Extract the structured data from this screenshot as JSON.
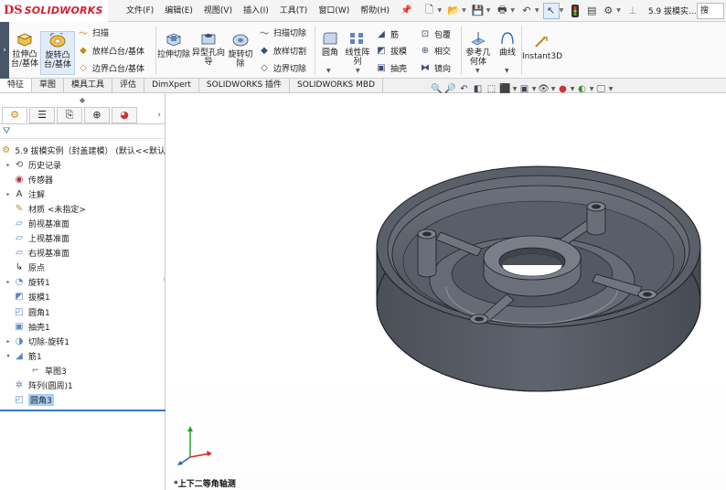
{
  "app": {
    "brand_mark": "DS",
    "brand_name": "SOLIDWORKS",
    "document_title": "5.9 拔模实...",
    "search_placeholder": "搜"
  },
  "menu": [
    "文件(F)",
    "编辑(E)",
    "视图(V)",
    "插入(I)",
    "工具(T)",
    "窗口(W)",
    "帮助(H)"
  ],
  "ribbon": {
    "extrude_boss": "拉伸凸台/基体",
    "revolve_boss": "旋转凸台/基体",
    "sweep": "扫描",
    "loft": "放样凸台/基体",
    "boundary_boss": "边界凸台/基体",
    "extrude_cut": "拉伸切除",
    "hole_wizard": "异型孔向导",
    "revolve_cut": "旋转切除",
    "swept_cut": "扫描切除",
    "lofted_cut": "放样切割",
    "boundary_cut": "边界切除",
    "fillet": "圆角",
    "linear_pattern": "线性阵列",
    "rib": "筋",
    "draft": "拔模",
    "shell": "抽壳",
    "wrap": "包覆",
    "intersect": "相交",
    "mirror": "镜向",
    "ref_geometry": "参考几何体",
    "curves": "曲线",
    "instant3d": "Instant3D"
  },
  "tabs": [
    "特征",
    "草图",
    "模具工具",
    "评估",
    "DimXpert",
    "SOLIDWORKS 插件",
    "SOLIDWORKS MBD"
  ],
  "tree": {
    "root": "5.9 拔模实例（封盖建模）  (默认<<默认",
    "items": [
      {
        "label": "历史记录",
        "icon": "history-icon",
        "exp": "▸"
      },
      {
        "label": "传感器",
        "icon": "sensor-icon",
        "exp": ""
      },
      {
        "label": "注解",
        "icon": "annotation-icon",
        "exp": "▸"
      },
      {
        "label": "材质 <未指定>",
        "icon": "material-icon",
        "exp": ""
      },
      {
        "label": "前视基准面",
        "icon": "plane-icon",
        "exp": ""
      },
      {
        "label": "上视基准面",
        "icon": "plane-icon",
        "exp": ""
      },
      {
        "label": "右视基准面",
        "icon": "plane-icon",
        "exp": ""
      },
      {
        "label": "原点",
        "icon": "origin-icon",
        "exp": ""
      },
      {
        "label": "旋转1",
        "icon": "revolve-icon",
        "exp": "▸"
      },
      {
        "label": "拔模1",
        "icon": "draft-icon",
        "exp": ""
      },
      {
        "label": "圆角1",
        "icon": "fillet-icon",
        "exp": ""
      },
      {
        "label": "抽壳1",
        "icon": "shell-icon",
        "exp": ""
      },
      {
        "label": "切除-旋转1",
        "icon": "revolve-cut-icon",
        "exp": "▸"
      },
      {
        "label": "筋1",
        "icon": "rib-icon",
        "exp": "▾"
      },
      {
        "label": "草图3",
        "icon": "sketch-icon",
        "exp": ""
      },
      {
        "label": "阵列(圆周)1",
        "icon": "circular-pattern-icon",
        "exp": ""
      },
      {
        "label": "圆角3",
        "icon": "fillet-icon",
        "exp": ""
      }
    ]
  },
  "viewport": {
    "view_name": "*上下二等角轴测"
  },
  "colors": {
    "brand": "#d2202f",
    "model_body": "#585c66",
    "selection": "#a9d0f5"
  }
}
